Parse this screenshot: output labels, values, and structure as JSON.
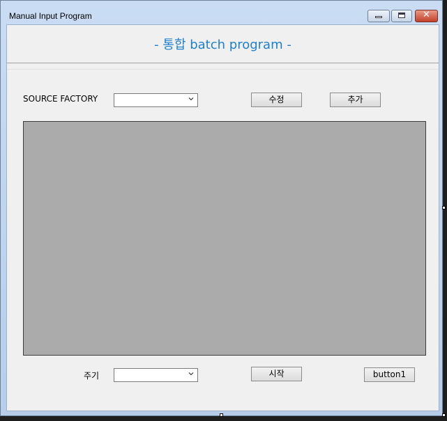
{
  "window": {
    "title": "Manual Input Program",
    "controls": {
      "minimize_icon": "minimize-icon",
      "maximize_icon": "maximize-icon",
      "close_icon": "close-icon"
    }
  },
  "header": {
    "title": "- 통합 batch program -",
    "accent_color": "#1f7fcf"
  },
  "top_row": {
    "source_factory_label": "SOURCE FACTORY",
    "source_factory_value": "",
    "edit_button": "수정",
    "add_button": "추가"
  },
  "grid": {
    "background_color": "#ababab"
  },
  "bottom_row": {
    "cycle_label": "주기",
    "cycle_value": "",
    "start_button": "시작",
    "button1": "button1"
  }
}
